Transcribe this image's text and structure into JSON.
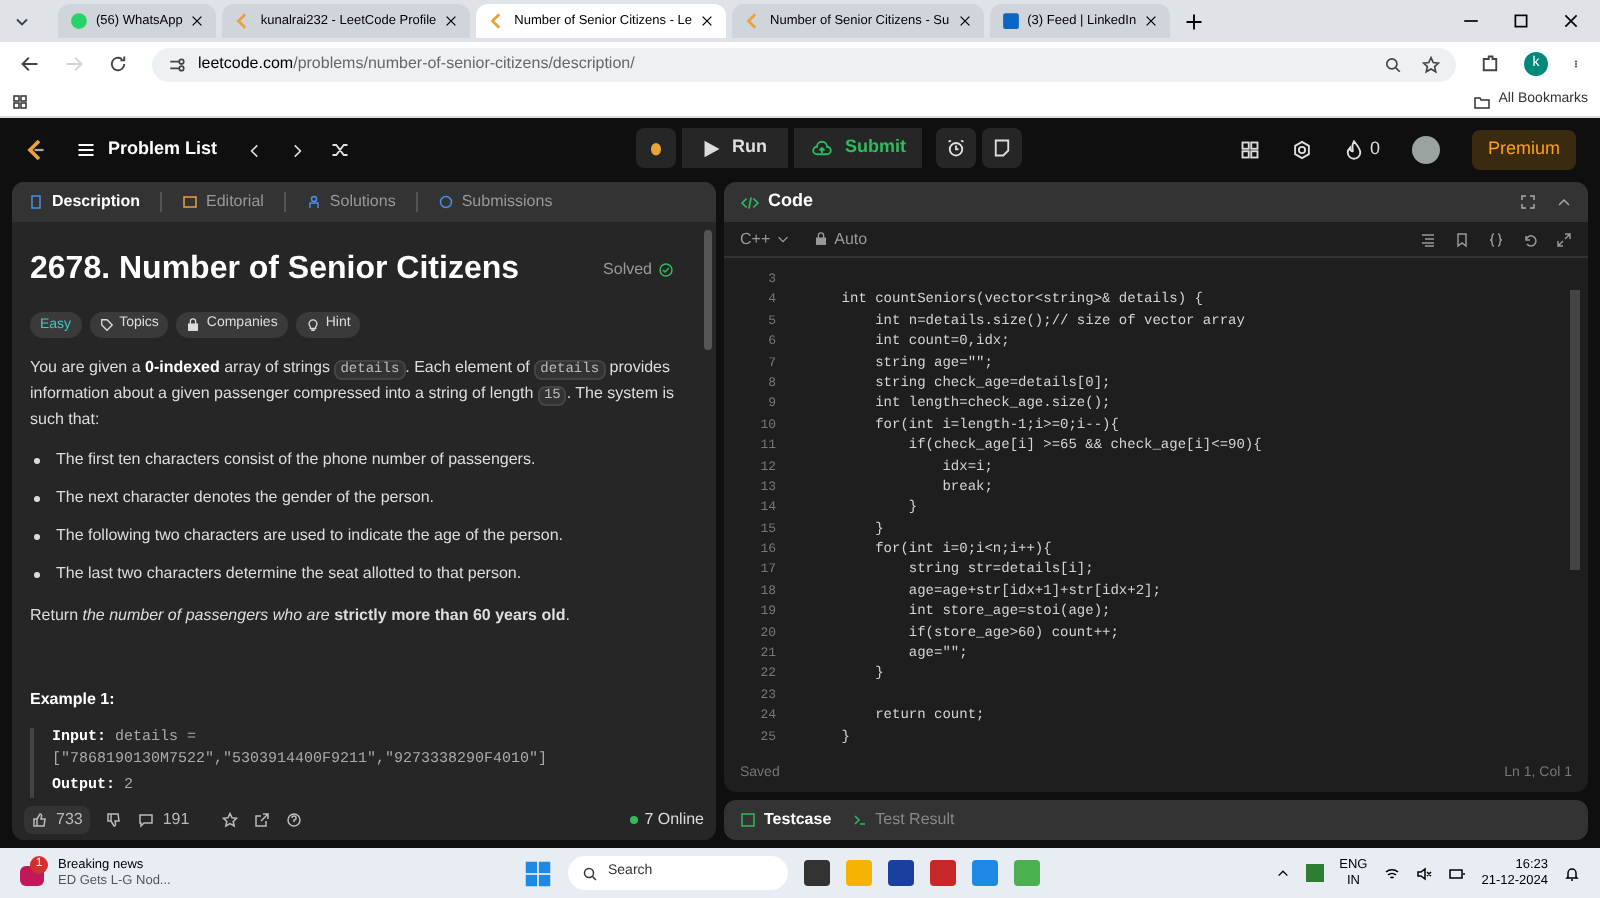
{
  "browser": {
    "tabs": [
      {
        "title": "(56) WhatsApp",
        "selected": false
      },
      {
        "title": "kunalrai232 - LeetCode Profile",
        "selected": false
      },
      {
        "title": "Number of Senior Citizens - Le",
        "selected": true
      },
      {
        "title": "Number of Senior Citizens - Su",
        "selected": false
      },
      {
        "title": "(3) Feed | LinkedIn",
        "selected": false
      }
    ],
    "url_host": "leetcode.com",
    "url_path": "/problems/number-of-senior-citizens/description/",
    "profile_initial": "k",
    "bookmarks": "All Bookmarks"
  },
  "navbar": {
    "problem_list": "Problem List",
    "run": "Run",
    "submit": "Submit",
    "streak": "0",
    "premium": "Premium"
  },
  "left_tabs": [
    {
      "label": "Description",
      "selected": true
    },
    {
      "label": "Editorial",
      "selected": false
    },
    {
      "label": "Solutions",
      "selected": false
    },
    {
      "label": "Submissions",
      "selected": false
    }
  ],
  "problem": {
    "title": "2678. Number of Senior Citizens",
    "status": "Solved",
    "difficulty": "Easy",
    "chips": [
      "Topics",
      "Companies",
      "Hint"
    ],
    "intro": [
      {
        "kind": "plain",
        "text": "You are given a "
      },
      {
        "kind": "bold",
        "text": "0-indexed"
      },
      {
        "kind": "plain",
        "text": " array of strings "
      },
      {
        "kind": "code",
        "text": "details"
      },
      {
        "kind": "plain",
        "text": ". Each element of "
      },
      {
        "kind": "code",
        "text": "details"
      },
      {
        "kind": "plain",
        "text": " provides information about a given passenger compressed into a string of length "
      },
      {
        "kind": "code",
        "text": "15"
      },
      {
        "kind": "plain",
        "text": ". The system is such that:"
      }
    ],
    "bullets": [
      "The first ten characters consist of the phone number of passengers.",
      "The next character denotes the gender of the person.",
      "The following two characters are used to indicate the age of the person.",
      "The last two characters determine the seat allotted to that person."
    ],
    "return_text": "Return *the number of passengers who are* **strictly more than 60 years old**.",
    "example_title": "Example 1:",
    "example": [
      {
        "label": "Input:",
        "value": "details =\n[\"7868190130M7522\",\"5303914400F9211\",\"9273338290F4010\"]"
      },
      {
        "label": "Output:",
        "value": "2"
      }
    ]
  },
  "footer": {
    "likes": "733",
    "comments": "191",
    "online": "7 Online"
  },
  "code_panel": {
    "title": "Code",
    "language": "C++",
    "mode": "Auto",
    "lines": [
      {
        "number": "3"
      },
      {
        "number": "4",
        "text": "    int countSeniors(vector<string>& details) {"
      },
      {
        "number": "5",
        "text": "        int n=details.size();// size of vector array"
      },
      {
        "number": "6",
        "text": "        int count=0,idx;"
      },
      {
        "number": "7",
        "text": "        string age=\"\";"
      },
      {
        "number": "8",
        "text": "        string check_age=details[0];"
      },
      {
        "number": "9",
        "text": "        int length=check_age.size();"
      },
      {
        "number": "10",
        "text": "        for(int i=length-1;i>=0;i--){"
      },
      {
        "number": "11",
        "text": "            if(check_age[i] >=65 && check_age[i]<=90){"
      },
      {
        "number": "12",
        "text": "                idx=i;"
      },
      {
        "number": "13",
        "text": "                break;"
      },
      {
        "number": "14",
        "text": "            }"
      },
      {
        "number": "15",
        "text": "        }"
      },
      {
        "number": "16",
        "text": "        for(int i=0;i<n;i++){"
      },
      {
        "number": "17",
        "text": "            string str=details[i];"
      },
      {
        "number": "18",
        "text": "            age=age+str[idx+1]+str[idx+2];"
      },
      {
        "number": "19",
        "text": "            int store_age=stoi(age);"
      },
      {
        "number": "20",
        "text": "            if(store_age>60) count++;"
      },
      {
        "number": "21",
        "text": "            age=\"\";"
      },
      {
        "number": "22",
        "text": "        }"
      },
      {
        "number": "23"
      },
      {
        "number": "24",
        "text": "        return count;"
      },
      {
        "number": "25",
        "text": "    }"
      }
    ],
    "saved": "Saved",
    "cursor": "Ln 1, Col 1"
  },
  "bottom_tabs": [
    {
      "label": "Testcase",
      "selected": true
    },
    {
      "label": "Test Result",
      "selected": false
    }
  ],
  "taskbar": {
    "news_title": "Breaking news",
    "news_sub": "ED Gets L-G Nod...",
    "news_badge": "1",
    "search": "Search",
    "lang": "ENG",
    "region": "IN",
    "time": "16:23",
    "date": "21-12-2024"
  }
}
